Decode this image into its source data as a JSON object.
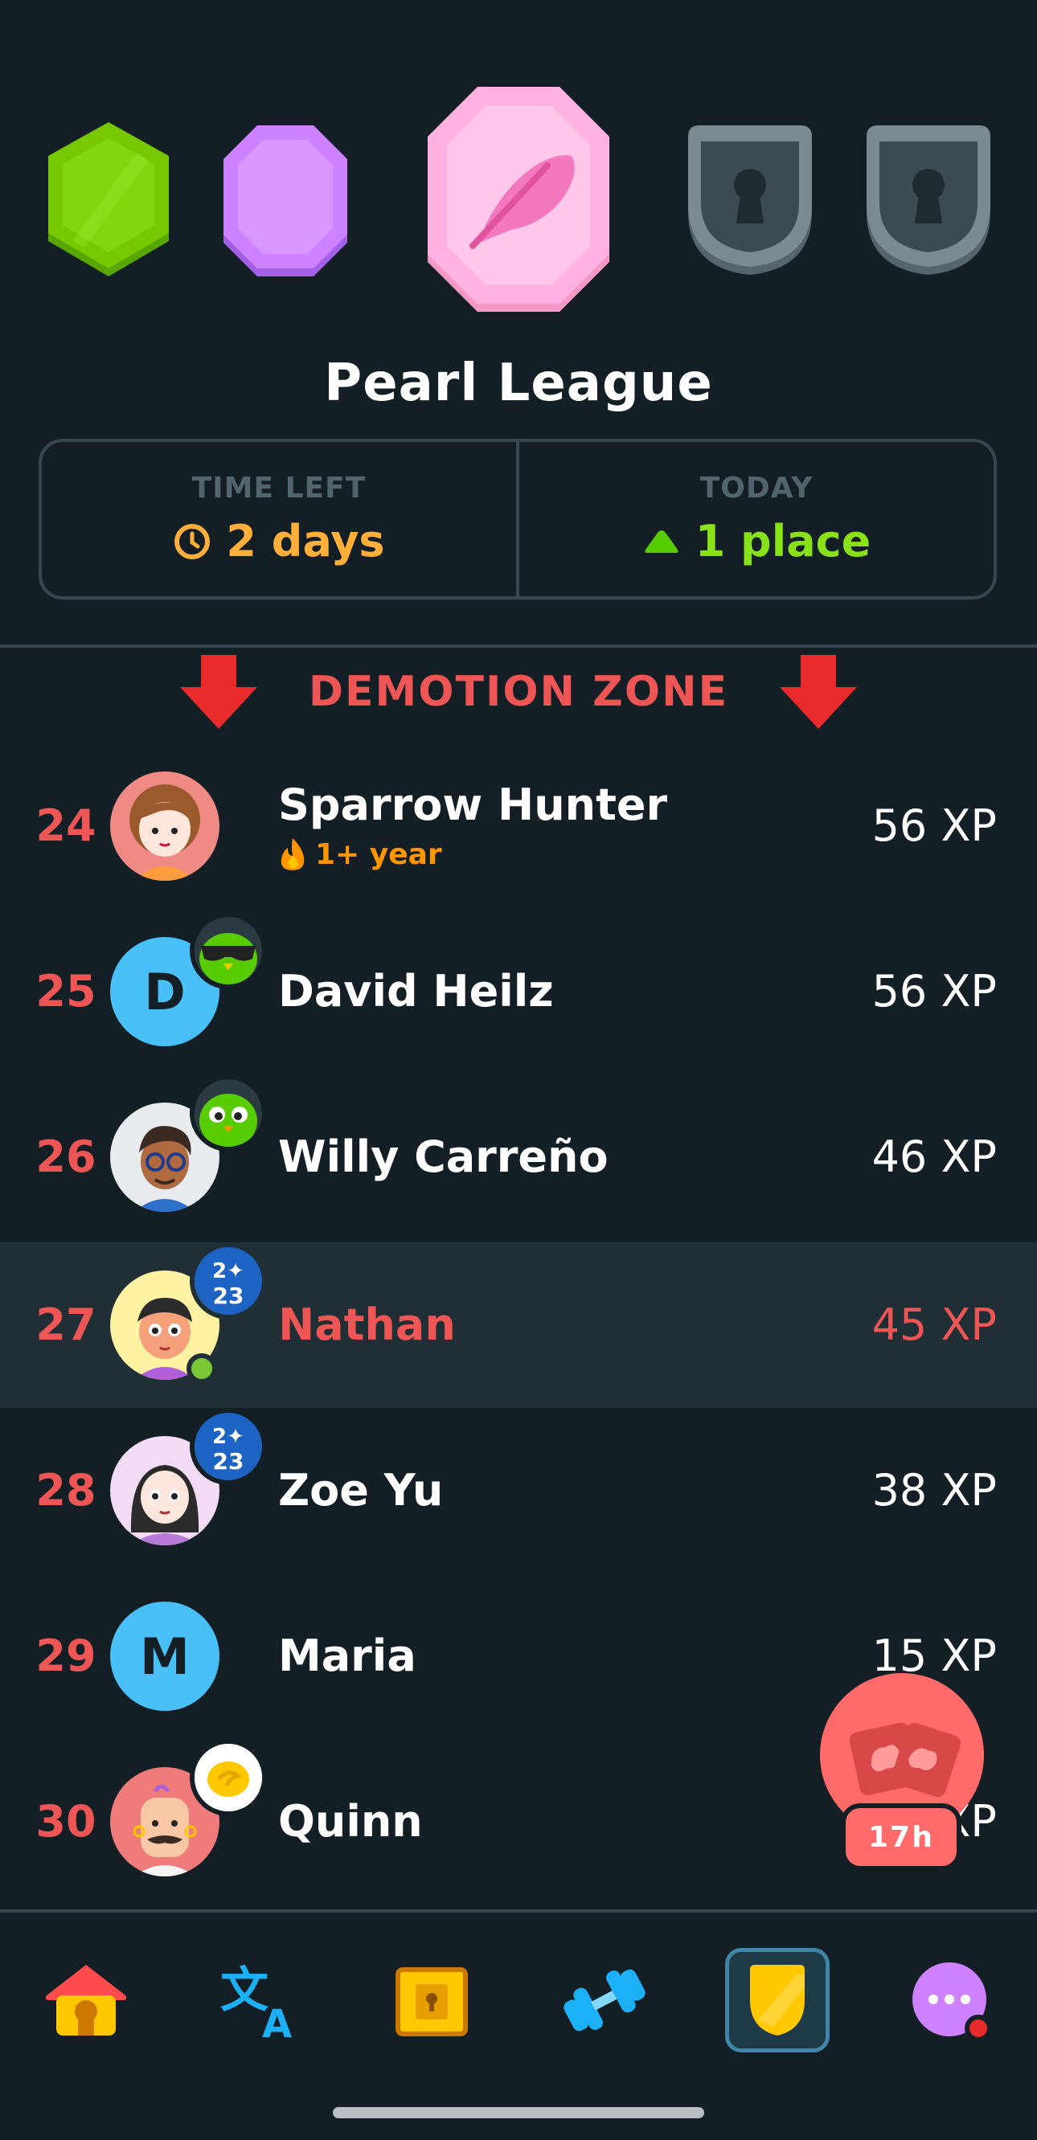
{
  "league": {
    "title": "Pearl League",
    "badges": [
      {
        "name": "emerald-league-badge",
        "color": "#78c800",
        "state": "completed"
      },
      {
        "name": "amethyst-league-badge",
        "color": "#ce82ff",
        "state": "completed"
      },
      {
        "name": "pearl-league-badge",
        "color": "#ffb2e1",
        "state": "current"
      },
      {
        "name": "locked-league-badge",
        "color": "#7c8a92",
        "state": "locked"
      },
      {
        "name": "locked-league-badge",
        "color": "#7c8a92",
        "state": "locked"
      }
    ]
  },
  "stats": {
    "time_left_label": "TIME LEFT",
    "time_left_value": "2 days",
    "today_label": "TODAY",
    "today_value": "1 place"
  },
  "zone": {
    "label": "DEMOTION ZONE"
  },
  "leaderboard": [
    {
      "rank": "24",
      "name": "Sparrow Hunter",
      "xp": "56 XP",
      "streak": "1+ year",
      "avatar": "illustrated-girl"
    },
    {
      "rank": "25",
      "name": "David Heilz",
      "xp": "56 XP",
      "avatar_letter": "D",
      "badge": "sunglasses-owl"
    },
    {
      "rank": "26",
      "name": "Willy Carreño",
      "xp": "46 XP",
      "avatar": "illustrated-man-glasses",
      "badge": "green-owl"
    },
    {
      "rank": "27",
      "name": "Nathan",
      "xp": "45 XP",
      "avatar": "illustrated-boy",
      "badge": "2023-sparkle",
      "badge_text": "20 23",
      "is_current_user": true
    },
    {
      "rank": "28",
      "name": "Zoe Yu",
      "xp": "38 XP",
      "avatar": "illustrated-woman",
      "badge": "2023-sparkle",
      "badge_text": "20 23"
    },
    {
      "rank": "29",
      "name": "Maria",
      "xp": "15 XP",
      "avatar_letter": "M"
    },
    {
      "rank": "30",
      "name": "Quinn",
      "xp": "XP",
      "avatar": "illustrated-man-mustache",
      "badge": "gold-coin"
    }
  ],
  "chest_button": {
    "timer": "17h"
  },
  "nav": {
    "items": [
      {
        "name": "home",
        "icon": "home-icon"
      },
      {
        "name": "languages",
        "icon": "translate-icon"
      },
      {
        "name": "chest",
        "icon": "treasure-chest-icon"
      },
      {
        "name": "practice",
        "icon": "dumbbell-icon"
      },
      {
        "name": "leaderboards",
        "icon": "shield-icon",
        "active": true
      },
      {
        "name": "more",
        "icon": "more-icon",
        "notification": true
      }
    ]
  },
  "colors": {
    "background": "#131f24",
    "highlight_row": "#202f36",
    "border": "#37464f",
    "danger": "#ee5555",
    "time_orange": "#ffaf3a",
    "green": "#89e219",
    "blue_avatar": "#49c0f8",
    "chest_button": "#ff6b6b"
  }
}
